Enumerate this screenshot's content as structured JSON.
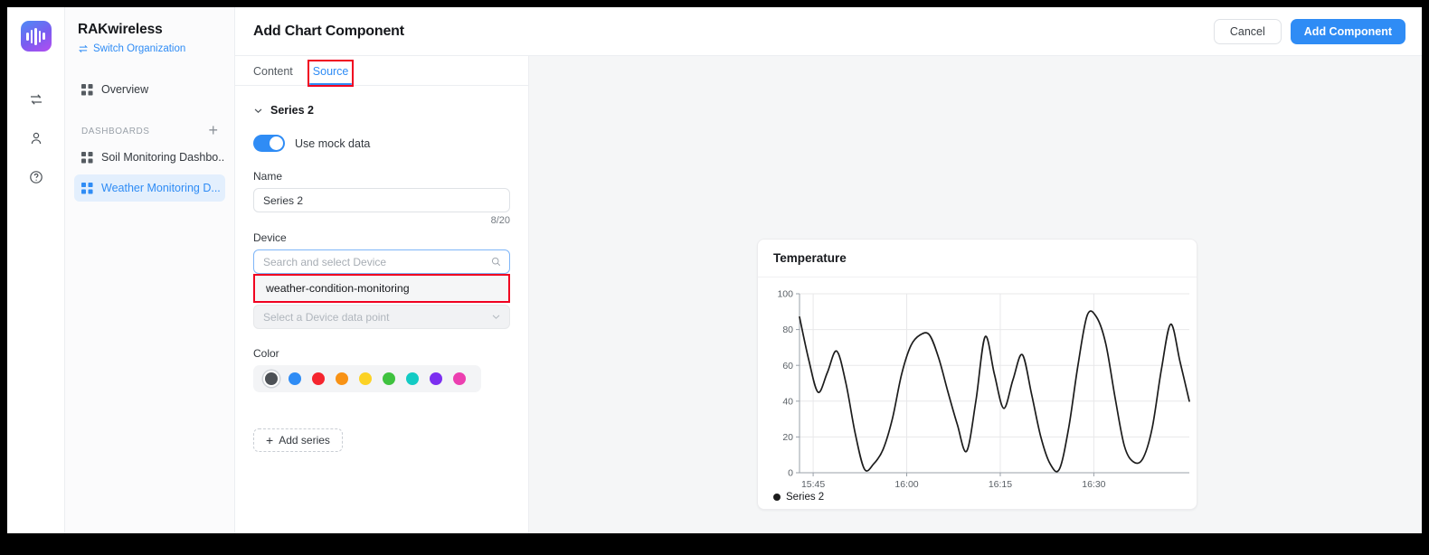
{
  "brand": {
    "logo_icon": "soundwave-logo-icon",
    "accent": "#2f8cf5"
  },
  "rail": {
    "icons": [
      {
        "name": "switch-transfer-icon"
      },
      {
        "name": "user-account-icon"
      },
      {
        "name": "help-circle-icon"
      }
    ]
  },
  "sidebar": {
    "org_name": "RAKwireless",
    "switch_org_label": "Switch Organization",
    "overview_label": "Overview",
    "section_title": "DASHBOARDS",
    "add_dashboard_label": "+",
    "dashboards": [
      {
        "label": "Soil Monitoring Dashbo...",
        "active": false
      },
      {
        "label": "Weather Monitoring D...",
        "active": true
      }
    ]
  },
  "topbar": {
    "title": "Add Chart Component",
    "cancel_label": "Cancel",
    "add_component_label": "Add Component"
  },
  "tabs": [
    {
      "label": "Content",
      "active": false
    },
    {
      "label": "Source",
      "active": true,
      "annotated": true
    }
  ],
  "form": {
    "series_header": "Series 2",
    "mock_toggle_label": "Use mock data",
    "mock_toggle_on": true,
    "name_label": "Name",
    "name_value": "Series 2",
    "name_counter": "8/20",
    "device_label": "Device",
    "device_search_placeholder": "Search and select Device",
    "device_options": [
      "weather-condition-monitoring"
    ],
    "data_point_placeholder": "Select a Device data point",
    "color_label": "Color",
    "colors": [
      "#4d5156",
      "#2f8cf5",
      "#f5252e",
      "#f89215",
      "#fcd225",
      "#3fc23f",
      "#13cbc4",
      "#7c2ff0",
      "#ec3fb0"
    ],
    "selected_color_index": 0,
    "add_series_label": "Add series"
  },
  "chart_data": {
    "type": "line",
    "title": "Temperature",
    "xlabel": "",
    "ylabel": "",
    "ylim": [
      0,
      100
    ],
    "yticks": [
      0,
      20,
      40,
      60,
      80,
      100
    ],
    "xticks": [
      "15:45",
      "16:00",
      "16:15",
      "16:30"
    ],
    "xtick_positions": [
      0.035,
      0.275,
      0.515,
      0.755
    ],
    "grid": true,
    "legend": [
      "Series 2"
    ],
    "legend_position": "bottom-left",
    "series": [
      {
        "name": "Series 2",
        "color": "#1c1c1c",
        "values": [
          87,
          63,
          45,
          56,
          68,
          50,
          22,
          2,
          5,
          13,
          30,
          55,
          71,
          77,
          77,
          64,
          45,
          27,
          12,
          40,
          76,
          55,
          36,
          52,
          66,
          44,
          20,
          5,
          2,
          25,
          60,
          88,
          87,
          72,
          42,
          15,
          6,
          8,
          25,
          58,
          83,
          62,
          40
        ]
      }
    ]
  }
}
